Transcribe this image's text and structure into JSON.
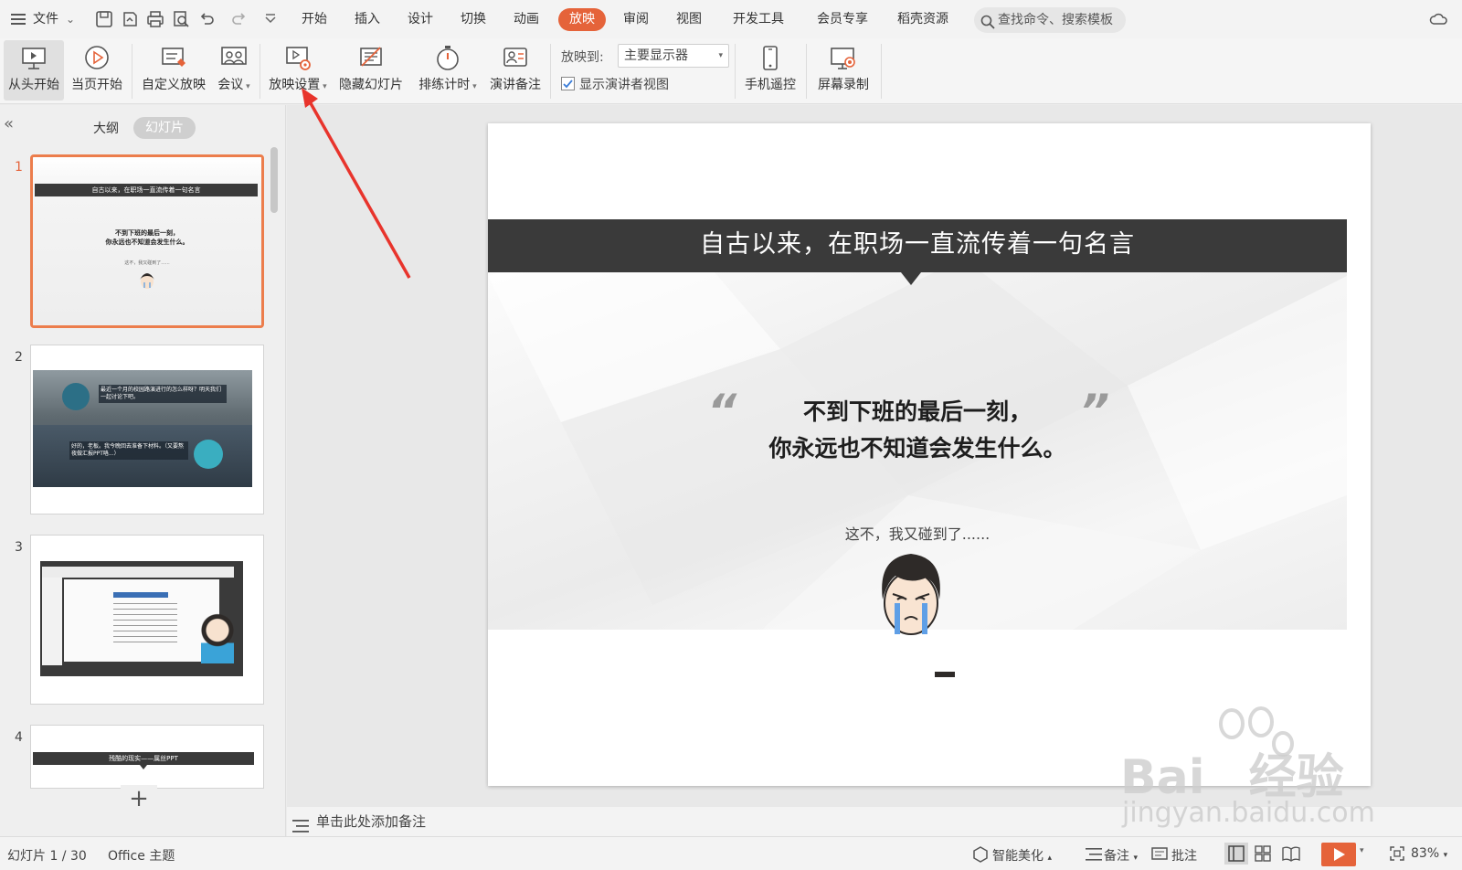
{
  "menubar": {
    "file_label": "文件",
    "tabs": [
      {
        "label": "开始"
      },
      {
        "label": "插入"
      },
      {
        "label": "设计"
      },
      {
        "label": "切换"
      },
      {
        "label": "动画"
      },
      {
        "label": "放映"
      },
      {
        "label": "审阅"
      },
      {
        "label": "视图"
      },
      {
        "label": "开发工具"
      },
      {
        "label": "会员专享"
      },
      {
        "label": "稻壳资源"
      }
    ],
    "active_tab": "放映",
    "search_placeholder": "查找命令、搜索模板"
  },
  "ribbon": {
    "from_start": "从头开始",
    "from_current": "当页开始",
    "custom_show": "自定义放映",
    "meeting": "会议",
    "show_settings": "放映设置",
    "hide_slide": "隐藏幻灯片",
    "rehearse": "排练计时",
    "speaker_notes": "演讲备注",
    "play_to_label": "放映到:",
    "play_to_value": "主要显示器",
    "presenter_view_label": "显示演讲者视图",
    "presenter_view_checked": true,
    "phone_remote": "手机遥控",
    "screen_record": "屏幕录制"
  },
  "left_panel": {
    "outline_tab": "大纲",
    "slides_tab": "幻灯片",
    "slide_numbers": [
      "1",
      "2",
      "3",
      "4"
    ],
    "thumb1": {
      "title": "自古以来，在职场一直流传着一句名言",
      "line1": "不到下班的最后一刻，",
      "line2": "你永远也不知道会发生什么。",
      "small": "这不，我又碰到了......"
    },
    "thumb2": {
      "bubble1": "最近一个月的校园路演进行的怎么样呀？明天我们一起讨论下吧。",
      "bubble2": "好的，老板。我今晚回去准备下材料。（又要熬夜做汇报PPT咯...）"
    },
    "thumb4": {
      "title": "残酷的现实——属丝PPT"
    },
    "add_label": "+"
  },
  "slide": {
    "banner": "自古以来，在职场一直流传着一句名言",
    "quote_line1": "不到下班的最后一刻，",
    "quote_line2": "你永远也不知道会发生什么。",
    "caption": "这不，我又碰到了......",
    "open_quote": "“",
    "close_quote": "”"
  },
  "notes_bar": {
    "placeholder": "单击此处添加备注"
  },
  "status": {
    "slide_count": "幻灯片 1 / 30",
    "theme": "Office 主题",
    "smart_beautify": "智能美化",
    "notes": "备注",
    "comments": "批注",
    "zoom": "83%"
  },
  "watermark": {
    "line1": "Bai",
    "line2": "经验",
    "url": "jingyan.baidu.com"
  },
  "colors": {
    "accent": "#e5633a",
    "banner": "#3a3a3a",
    "selection": "#ec7d4c",
    "arrow": "#e8342c"
  }
}
